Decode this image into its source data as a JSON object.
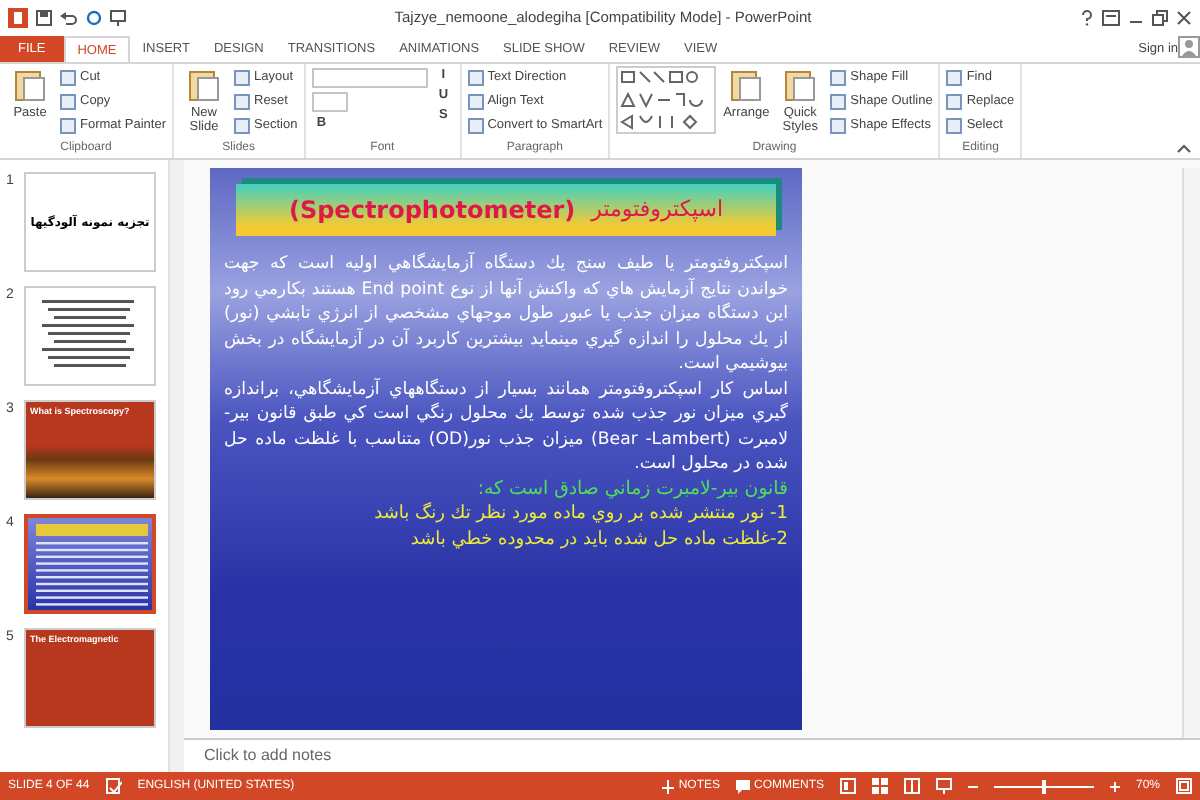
{
  "window": {
    "title": "Tajzye_nemoone_alodegiha [Compatibility Mode] - PowerPoint"
  },
  "ribbon_tabs": [
    {
      "label": "FILE",
      "selected": false,
      "kind": "file"
    },
    {
      "label": "HOME",
      "selected": true,
      "kind": "tab"
    },
    {
      "label": "INSERT",
      "selected": false,
      "kind": "tab"
    },
    {
      "label": "DESIGN",
      "selected": false,
      "kind": "tab"
    },
    {
      "label": "TRANSITIONS",
      "selected": false,
      "kind": "tab"
    },
    {
      "label": "ANIMATIONS",
      "selected": false,
      "kind": "tab"
    },
    {
      "label": "SLIDE SHOW",
      "selected": false,
      "kind": "tab"
    },
    {
      "label": "REVIEW",
      "selected": false,
      "kind": "tab"
    },
    {
      "label": "VIEW",
      "selected": false,
      "kind": "tab"
    }
  ],
  "account": {
    "label": "Sign in"
  },
  "ribbon_groups": [
    {
      "label": "Clipboard",
      "items": [
        {
          "kind": "large",
          "label": "Paste"
        },
        {
          "kind": "small",
          "label": "Cut"
        },
        {
          "kind": "small",
          "label": "Copy"
        },
        {
          "kind": "small",
          "label": "Format Painter"
        }
      ]
    },
    {
      "label": "Slides",
      "items": [
        {
          "kind": "large",
          "label": "New Slide"
        },
        {
          "kind": "small",
          "label": "Layout"
        },
        {
          "kind": "small",
          "label": "Reset"
        },
        {
          "kind": "small",
          "label": "Section"
        }
      ]
    },
    {
      "label": "Font",
      "items": [
        {
          "kind": "fields"
        },
        {
          "kind": "letter",
          "label": "B"
        },
        {
          "kind": "letter",
          "label": "I"
        },
        {
          "kind": "letter",
          "label": "U"
        },
        {
          "kind": "letter",
          "label": "S"
        }
      ]
    },
    {
      "label": "Paragraph",
      "items": [
        {
          "kind": "small",
          "label": "Text Direction"
        },
        {
          "kind": "small",
          "label": "Align Text"
        },
        {
          "kind": "small",
          "label": "Convert to SmartArt"
        }
      ]
    },
    {
      "label": "Drawing",
      "items": [
        {
          "kind": "gallery"
        },
        {
          "kind": "large",
          "label": "Arrange"
        },
        {
          "kind": "large",
          "label": "Quick Styles"
        },
        {
          "kind": "small",
          "label": "Shape Fill"
        },
        {
          "kind": "small",
          "label": "Shape Outline"
        },
        {
          "kind": "small",
          "label": "Shape Effects"
        }
      ]
    },
    {
      "label": "Editing",
      "items": [
        {
          "kind": "small",
          "label": "Find"
        },
        {
          "kind": "small",
          "label": "Replace"
        },
        {
          "kind": "small",
          "label": "Select"
        }
      ]
    }
  ],
  "slides": [
    {
      "number": "1",
      "kind": "title",
      "title": "تجزیه نمونه آلودگیها",
      "selected": false
    },
    {
      "number": "2",
      "kind": "bullets",
      "selected": false
    },
    {
      "number": "3",
      "kind": "photo",
      "title": "What is Spectroscopy?",
      "selected": false
    },
    {
      "number": "4",
      "kind": "blue",
      "selected": true
    },
    {
      "number": "5",
      "kind": "banner",
      "title": "The Electromagnetic",
      "selected": false
    }
  ],
  "slide": {
    "title_fa": "اسپکتروفتومتر",
    "title_en": "(Spectrophotometer)",
    "paragraphs": [
      {
        "kind": "body",
        "text": "اسپکتروفتومتر یا طیف سنج یك دستگاه آزمایشگاهي اولیه است که جهت خواندن نتایج آزمایش هاي که واکنش آنها از نوع End point هستند بکارمي رود این دستگاه میزان جذب یا عبور طول موجهاي مشخصي از انرژي تابشي (نور) از یك محلول را اندازه گیري مینماید بیشترین کاربرد آن در آزمایشگاه در بخش بیوشیمي است."
      },
      {
        "kind": "body",
        "text": "اساس کار اسپکتروفتومتر همانند بسیار از دستگاههاي آزمایشگاهي، براندازه گیري میزان نور جذب شده توسط یك محلول رنگي است کي طبق قانون بیر-لامبرت (Bear -Lambert) میزان جذب نور(OD) متناسب با غلظت ماده حل شده در محلول است."
      },
      {
        "kind": "heading",
        "text": "قانون بیر-لامبرت زماني صادق است که:"
      },
      {
        "kind": "point",
        "text": "1- نور منتشر شده بر روي ماده مورد نظر تك رنگ باشد"
      },
      {
        "kind": "point",
        "text": "2-غلظت ماده حل شده باید در محدوده خطي باشد"
      }
    ]
  },
  "notes": {
    "placeholder": "Click to add notes"
  },
  "status_bar": {
    "slide_info": "SLIDE 4 OF 44",
    "language": "ENGLISH (UNITED STATES)",
    "notes": "NOTES",
    "comments": "COMMENTS",
    "zoom": {
      "level": 0.5,
      "reading": "70%"
    }
  }
}
